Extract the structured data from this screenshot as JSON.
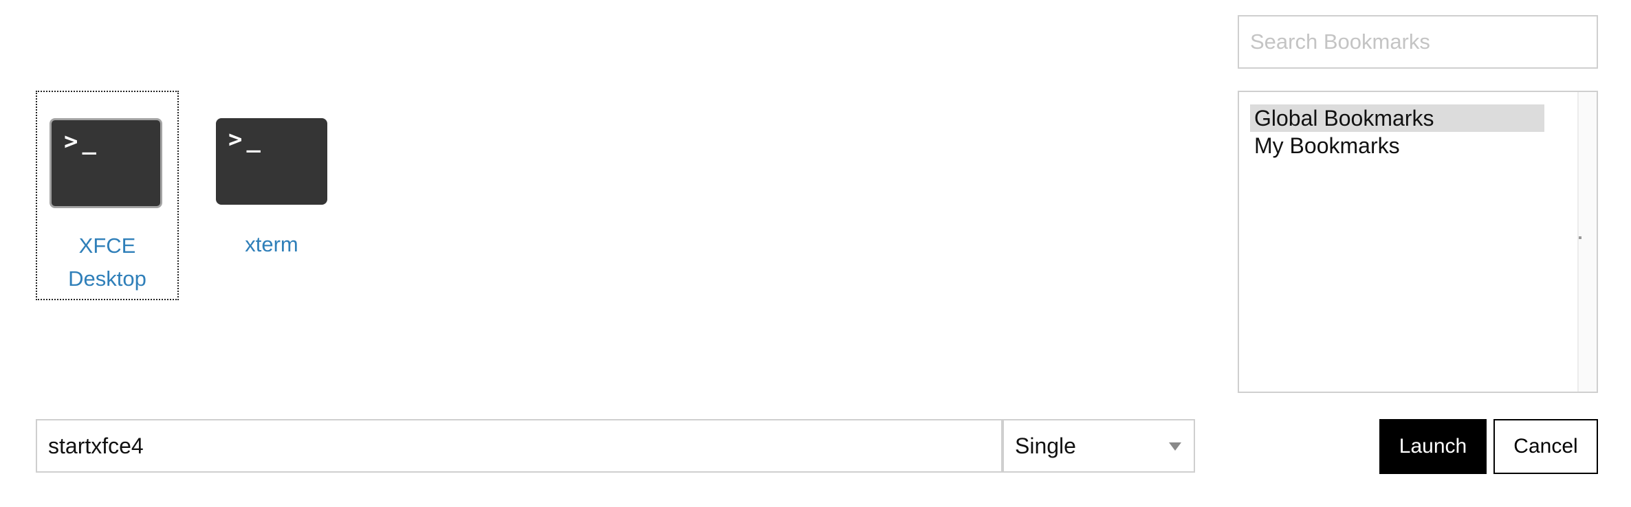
{
  "apps": [
    {
      "label_line1": "XFCE",
      "label_line2": "Desktop",
      "icon": "terminal-icon",
      "selected": true
    },
    {
      "label_line1": "xterm",
      "icon": "terminal-icon",
      "selected": false
    }
  ],
  "terminal_prompt": ">_",
  "command": {
    "value": "startxfce4"
  },
  "mode": {
    "selected": "Single"
  },
  "bookmarks": {
    "search_placeholder": "Search Bookmarks",
    "items": [
      {
        "label": "Global Bookmarks",
        "selected": true
      },
      {
        "label": "My Bookmarks",
        "selected": false
      }
    ]
  },
  "buttons": {
    "launch": "Launch",
    "cancel": "Cancel"
  },
  "colors": {
    "app_label": "#2f7fb9",
    "terminal_icon_bg": "#353535",
    "launch_bg": "#000000",
    "selected_item_bg": "#dcdcdc"
  }
}
